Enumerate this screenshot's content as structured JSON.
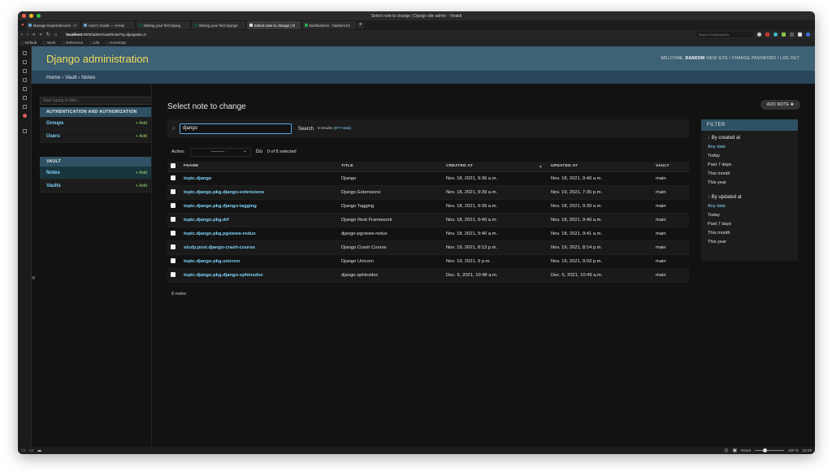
{
  "browser": {
    "window_title": "Select note to change | Django site admin - Vivaldi",
    "tabs": [
      {
        "label": "Manage Dependencies - V"
      },
      {
        "label": "User's Guide — Arrow"
      },
      {
        "label": "Writing your first Djang"
      },
      {
        "label": "Writing your first Django"
      },
      {
        "label": "Select note to change | D"
      },
      {
        "label": "Notifications - hackers.tm"
      }
    ],
    "url_host": "localhost",
    "url_rest": ":8000/admin/vault/note/?q=django&o=3",
    "search_placeholder": "Search DuckDuckGo",
    "bookmarks": [
      "Default",
      "Work",
      "Reference",
      "Life",
      "HomeOps"
    ],
    "status_zoom": "100 %",
    "status_reset": "Reset",
    "status_time": "22:29"
  },
  "header": {
    "branding": "Django administration",
    "welcome": "WELCOME,",
    "username": "RANDOM",
    "view_site": "VIEW SITE",
    "change_password": "CHANGE PASSWORD",
    "log_out": "LOG OUT"
  },
  "breadcrumbs": "Home › Vault › Notes",
  "sidebar": {
    "filter_placeholder": "Start typing to filter...",
    "modules": [
      {
        "caption": "AUTHENTICATION AND AUTHORIZATION",
        "rows": [
          {
            "name": "Groups",
            "add": "+ Add"
          },
          {
            "name": "Users",
            "add": "+ Add"
          }
        ]
      },
      {
        "caption": "VAULT",
        "rows": [
          {
            "name": "Notes",
            "add": "+ Add"
          },
          {
            "name": "Vaults",
            "add": "+ Add"
          }
        ]
      }
    ],
    "collapse_label": "«"
  },
  "content": {
    "title": "Select note to change",
    "add_button": "ADD NOTE ✚",
    "search_value": "django",
    "search_button": "Search",
    "results_text": "8 results",
    "results_total": "(877 total)",
    "action_label": "Action:",
    "action_selected": "———",
    "go_button": "Go",
    "selected_count": "0 of 8 selected",
    "columns": [
      "FNAME",
      "TITLE",
      "CREATED AT",
      "UPDATED AT",
      "VAULT"
    ],
    "rows": [
      {
        "fname": "topic.django",
        "title": "Django",
        "created": "Nov. 18, 2021, 9:36 a.m.",
        "updated": "Nov. 18, 2021, 9:40 a.m.",
        "vault": "main"
      },
      {
        "fname": "topic.django.pkg.django-extensions",
        "title": "Django Extensions",
        "created": "Nov. 18, 2021, 9:39 a.m.",
        "updated": "Nov. 19, 2021, 7:35 p.m.",
        "vault": "main"
      },
      {
        "fname": "topic.django.pkg.django-tagging",
        "title": "Django Tagging",
        "created": "Nov. 18, 2021, 9:39 a.m.",
        "updated": "Nov. 18, 2021, 9:39 a.m.",
        "vault": "main"
      },
      {
        "fname": "topic.django.pkg.drf",
        "title": "Django Rest Framework",
        "created": "Nov. 18, 2021, 9:40 a.m.",
        "updated": "Nov. 18, 2021, 9:40 a.m.",
        "vault": "main"
      },
      {
        "fname": "topic.django.pkg.pgviews-redux",
        "title": "django-pgviews-redux",
        "created": "Nov. 18, 2021, 9:40 a.m.",
        "updated": "Nov. 18, 2021, 9:41 a.m.",
        "vault": "main"
      },
      {
        "fname": "study.post.django-crash-course",
        "title": "Django Crash Course",
        "created": "Nov. 19, 2021, 8:13 p.m.",
        "updated": "Nov. 19, 2021, 8:14 p.m.",
        "vault": "main"
      },
      {
        "fname": "topic.django.pkg.unicorn",
        "title": "Django Unicorn",
        "created": "Nov. 19, 2021, 9 p.m.",
        "updated": "Nov. 19, 2021, 9:03 p.m.",
        "vault": "main"
      },
      {
        "fname": "topic.django.pkg.django-sphinxdoc",
        "title": "django-sphinxdoc",
        "created": "Dec. 5, 2021, 10:48 a.m.",
        "updated": "Dec. 5, 2021, 10:49 a.m.",
        "vault": "main"
      }
    ],
    "paginator": "8 notes"
  },
  "filter": {
    "caption": "FILTER",
    "groups": [
      {
        "title": "By created at",
        "options": [
          "Any date",
          "Today",
          "Past 7 days",
          "This month",
          "This year"
        ]
      },
      {
        "title": "By updated at",
        "options": [
          "Any date",
          "Today",
          "Past 7 days",
          "This month",
          "This year"
        ]
      }
    ]
  }
}
